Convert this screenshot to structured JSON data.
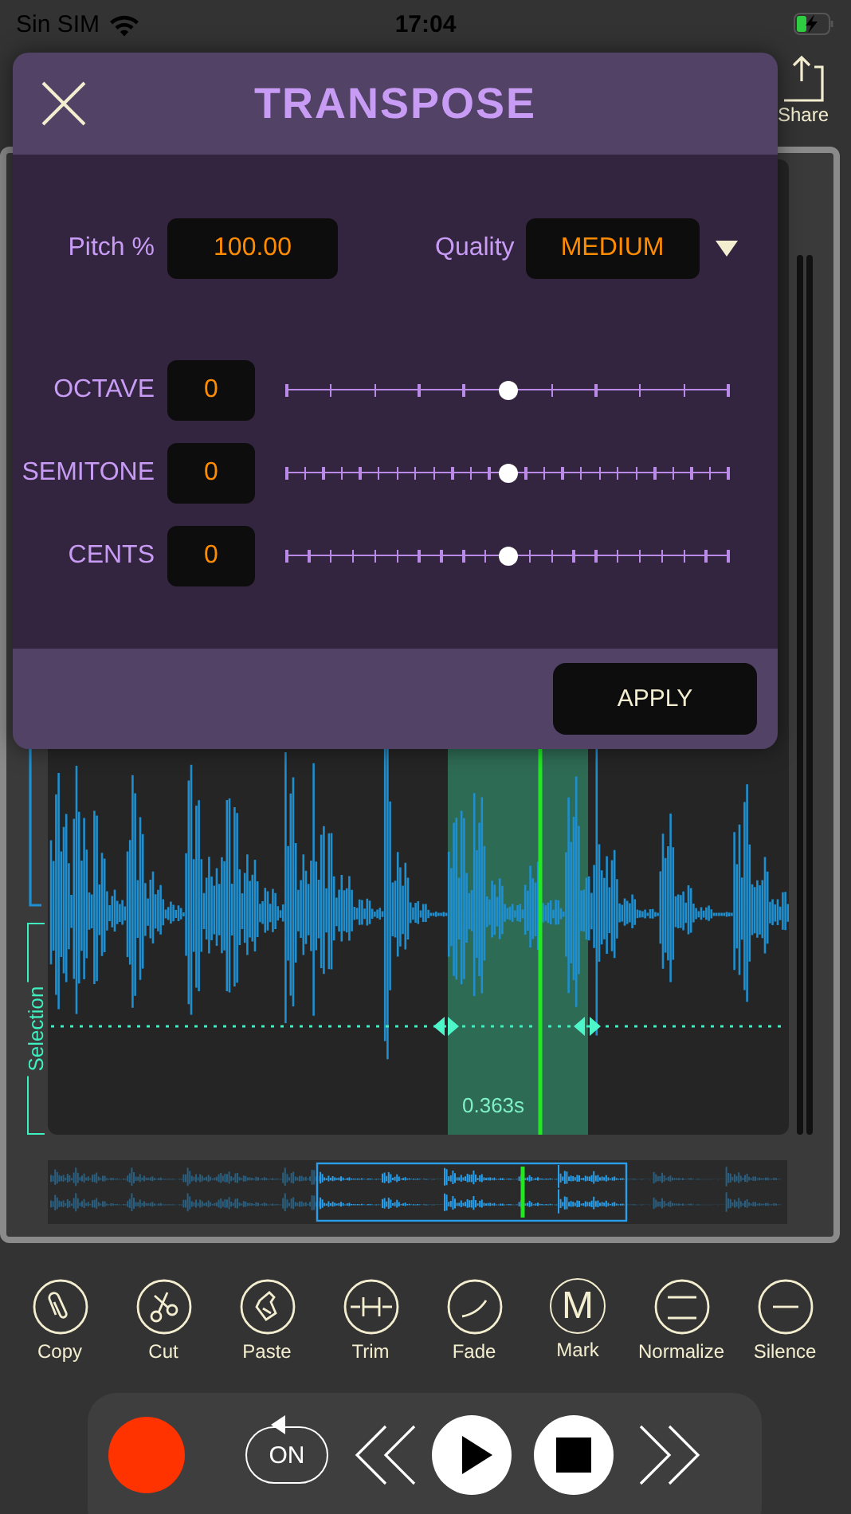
{
  "status_bar": {
    "carrier": "Sin SIM",
    "time": "17:04"
  },
  "share": {
    "label": "Share"
  },
  "editor": {
    "selection_label": "Selection",
    "selection_duration": "0.363s"
  },
  "dialog": {
    "title": "TRANSPOSE",
    "pitch": {
      "label": "Pitch %",
      "value": "100.00"
    },
    "quality": {
      "label": "Quality",
      "value": "MEDIUM"
    },
    "sliders": [
      {
        "label": "OCTAVE",
        "value": "0",
        "level": 0.5
      },
      {
        "label": "SEMITONE",
        "value": "0",
        "level": 0.5
      },
      {
        "label": "CENTS",
        "value": "0",
        "level": 0.5
      }
    ],
    "apply": "APPLY"
  },
  "tools": [
    {
      "kind": "copy",
      "label": "Copy"
    },
    {
      "kind": "cut",
      "label": "Cut"
    },
    {
      "kind": "paste",
      "label": "Paste"
    },
    {
      "kind": "trim",
      "label": "Trim"
    },
    {
      "kind": "fade",
      "label": "Fade"
    },
    {
      "kind": "mark",
      "label": "Mark",
      "glyph": "M"
    },
    {
      "kind": "normalize",
      "label": "Normalize"
    },
    {
      "kind": "silence",
      "label": "Silence"
    }
  ],
  "transport": {
    "loop": "ON"
  }
}
